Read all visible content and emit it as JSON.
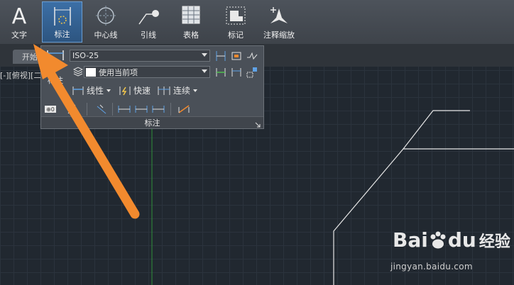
{
  "ribbon": {
    "buttons": [
      {
        "label": "文字",
        "icon": "text-A-icon"
      },
      {
        "label": "标注",
        "icon": "dimension-icon",
        "active": true
      },
      {
        "label": "中心线",
        "icon": "centerline-icon"
      },
      {
        "label": "引线",
        "icon": "leader-icon"
      },
      {
        "label": "表格",
        "icon": "table-icon"
      },
      {
        "label": "标记",
        "icon": "markup-icon"
      },
      {
        "label": "注释缩放",
        "icon": "annotation-scale-icon"
      }
    ]
  },
  "tabs": {
    "start": "开始"
  },
  "viewport": {
    "label": "[-][俯视][二"
  },
  "dimension_panel": {
    "big_button_label": "标注",
    "dimstyle_value": "ISO-25",
    "layer_value": "使用当前项",
    "linear_label": "线性",
    "quick_label": "快速",
    "continue_label": "连续",
    "footer_title": "标注"
  },
  "watermark": {
    "logo_text": "Bai",
    "logo_du": "du",
    "cn_text": "经验",
    "url": "jingyan.baidu.com"
  },
  "colors": {
    "canvas_bg": "#212830",
    "grid": "#2b333d",
    "axis_y": "#2f8f3a",
    "ribbon_active": "#3c6fa6",
    "arrow": "#f28a2e",
    "geometry": "#e6e6e6"
  }
}
